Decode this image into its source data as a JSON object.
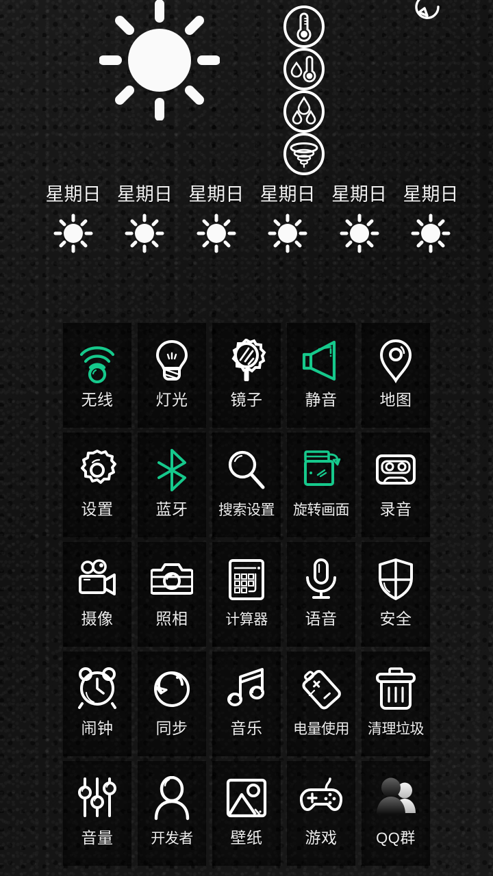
{
  "theme": {
    "background_color": "#141414",
    "tile_color": "#0a0a0a",
    "accent_green": "#16c98c",
    "icon_white": "#ffffff",
    "label_color": "#ededed"
  },
  "weather": {
    "refresh_icon": "refresh-icon",
    "condition_icon": "sun-icon",
    "stats": [
      {
        "name": "temperature",
        "icon": "thermometer-icon"
      },
      {
        "name": "feels-like",
        "icon": "thermometer-humidity-icon"
      },
      {
        "name": "rainfall",
        "icon": "raindrops-icon"
      },
      {
        "name": "wind",
        "icon": "tornado-icon"
      }
    ],
    "forecast": [
      {
        "day": "星期日",
        "icon": "sun-icon"
      },
      {
        "day": "星期日",
        "icon": "sun-icon"
      },
      {
        "day": "星期日",
        "icon": "sun-icon"
      },
      {
        "day": "星期日",
        "icon": "sun-icon"
      },
      {
        "day": "星期日",
        "icon": "sun-icon"
      },
      {
        "day": "星期日",
        "icon": "sun-icon"
      }
    ]
  },
  "toolbox": {
    "items": [
      {
        "label": "无线",
        "icon": "wifi-icon",
        "color": "green"
      },
      {
        "label": "灯光",
        "icon": "lightbulb-icon",
        "color": "white"
      },
      {
        "label": "镜子",
        "icon": "mirror-icon",
        "color": "white"
      },
      {
        "label": "静音",
        "icon": "speaker-mute-icon",
        "color": "green"
      },
      {
        "label": "地图",
        "icon": "map-pin-icon",
        "color": "white"
      },
      {
        "label": "设置",
        "icon": "gear-icon",
        "color": "white"
      },
      {
        "label": "蓝牙",
        "icon": "bluetooth-icon",
        "color": "green"
      },
      {
        "label": "搜索设置",
        "icon": "magnifier-icon",
        "color": "white"
      },
      {
        "label": "旋转画面",
        "icon": "rotate-screen-icon",
        "color": "green"
      },
      {
        "label": "录音",
        "icon": "cassette-icon",
        "color": "white"
      },
      {
        "label": "摄像",
        "icon": "video-camera-icon",
        "color": "white"
      },
      {
        "label": "照相",
        "icon": "camera-icon",
        "color": "white"
      },
      {
        "label": "计算器",
        "icon": "calculator-icon",
        "color": "white"
      },
      {
        "label": "语音",
        "icon": "microphone-icon",
        "color": "white"
      },
      {
        "label": "安全",
        "icon": "shield-icon",
        "color": "white"
      },
      {
        "label": "闹钟",
        "icon": "alarm-clock-icon",
        "color": "white"
      },
      {
        "label": "同步",
        "icon": "sync-icon",
        "color": "white"
      },
      {
        "label": "音乐",
        "icon": "music-note-icon",
        "color": "white"
      },
      {
        "label": "电量使用",
        "icon": "battery-icon",
        "color": "white"
      },
      {
        "label": "清理垃圾",
        "icon": "trash-icon",
        "color": "white"
      },
      {
        "label": "音量",
        "icon": "sliders-icon",
        "color": "white"
      },
      {
        "label": "开发者",
        "icon": "person-icon",
        "color": "white"
      },
      {
        "label": "壁纸",
        "icon": "picture-icon",
        "color": "white"
      },
      {
        "label": "游戏",
        "icon": "gamepad-icon",
        "color": "white"
      },
      {
        "label": "QQ群",
        "icon": "qq-group-icon",
        "color": "gray"
      }
    ]
  }
}
